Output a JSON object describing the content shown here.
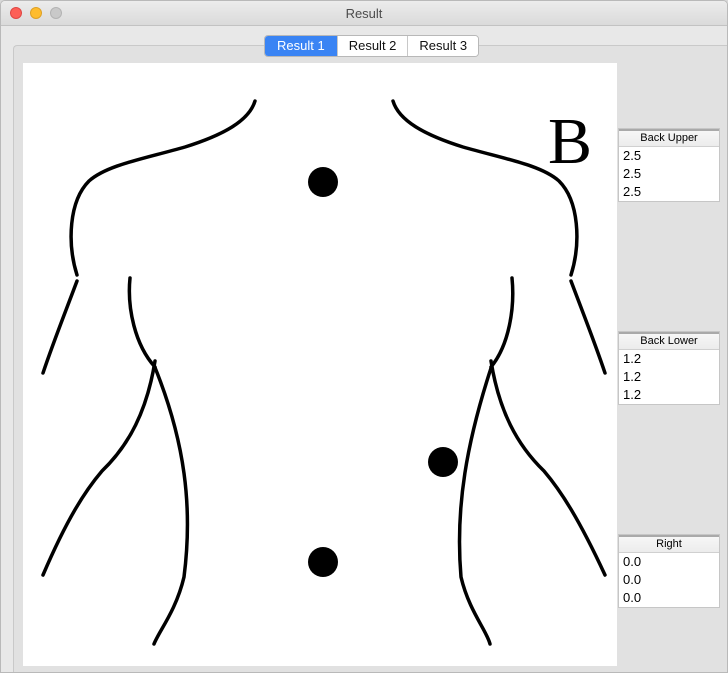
{
  "window": {
    "title": "Result"
  },
  "tabs": [
    {
      "label": "Result 1",
      "selected": true
    },
    {
      "label": "Result 2",
      "selected": false
    },
    {
      "label": "Result 3",
      "selected": false
    }
  ],
  "figure": {
    "view_letter": "B"
  },
  "panels": {
    "back_upper": {
      "header": "Back Upper",
      "values": [
        "2.5",
        "2.5",
        "2.5"
      ]
    },
    "back_lower": {
      "header": "Back Lower",
      "values": [
        "1.2",
        "1.2",
        "1.2"
      ]
    },
    "right": {
      "header": "Right",
      "values": [
        "0.0",
        "0.0",
        "0.0"
      ]
    }
  }
}
